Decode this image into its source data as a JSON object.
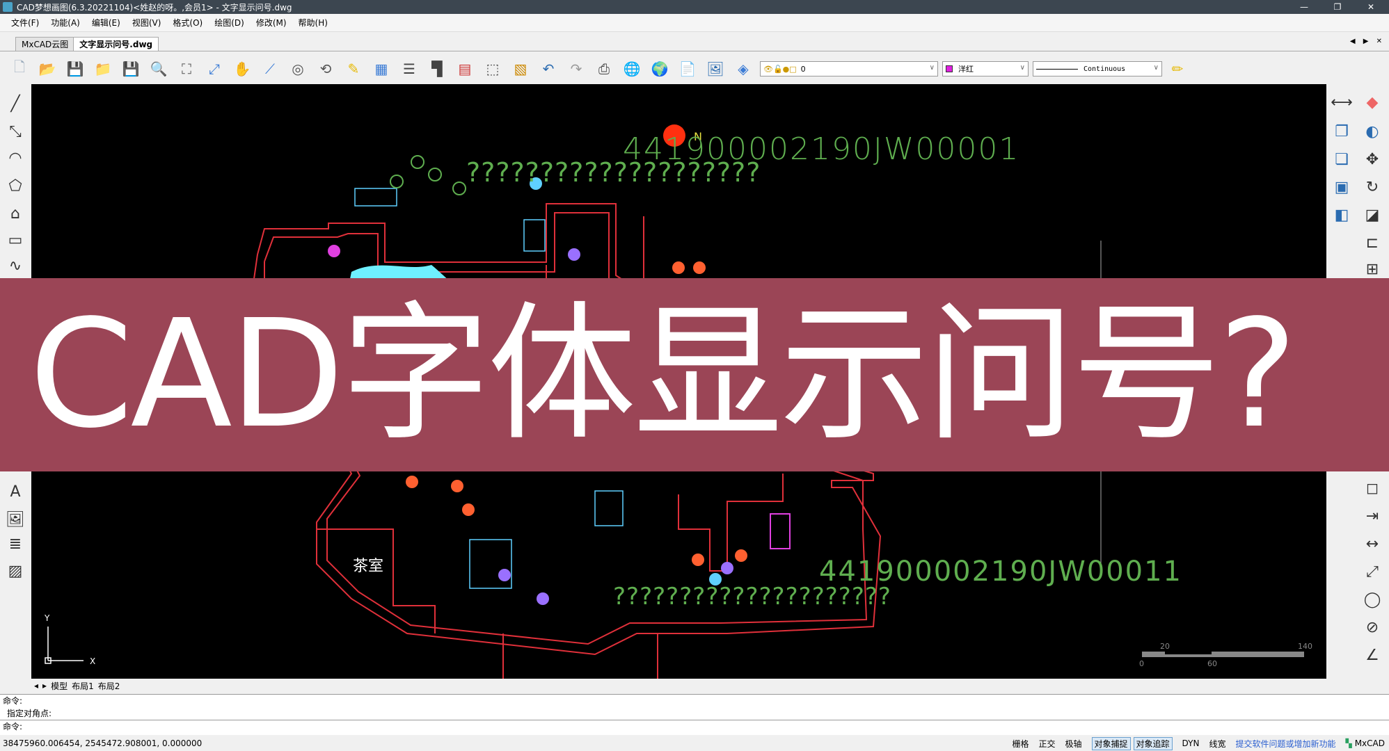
{
  "window": {
    "title": "CAD梦想画图(6.3.20221104)<姓赵的呀。,会员1> - 文字显示问号.dwg",
    "minimize": "—",
    "restore": "❐",
    "close": "✕"
  },
  "menu": [
    "文件(F)",
    "功能(A)",
    "编辑(E)",
    "视图(V)",
    "格式(O)",
    "绘图(D)",
    "修改(M)",
    "帮助(H)"
  ],
  "doc_tabs": [
    {
      "label": "MxCAD云图",
      "active": false
    },
    {
      "label": "文字显示问号.dwg",
      "active": true
    }
  ],
  "doc_tab_arrows": "◀ ▶ ✕",
  "toolbar": {
    "icons": [
      "new-file",
      "open-folder",
      "save",
      "open",
      "save-as",
      "zoom-in",
      "zoom-window",
      "zoom-extents",
      "pan-hand",
      "ucs",
      "zoom-realtime",
      "zoom-previous",
      "pencil",
      "properties",
      "layers-list",
      "block",
      "color-palette",
      "select",
      "match",
      "undo",
      "redo",
      "print",
      "web",
      "globe",
      "pdf",
      "image"
    ],
    "layer_value": "0",
    "color_value": "洋红",
    "color_swatch": "#e020e0",
    "linetype_value": "Continuous"
  },
  "canvas": {
    "text_top_code": "441900002190JW00001",
    "text_top_question": "????????????????????",
    "text_bottom_code": "441900002190JW00011",
    "text_bottom_question": "?????????????????????",
    "room_label": "茶室",
    "north_label": "N",
    "axis_x": "X",
    "axis_y": "Y",
    "scale_labels": [
      "0",
      "20",
      "60",
      "140"
    ],
    "colors": {
      "wall": "#e0303a",
      "pond": "#6ef0ff",
      "text": "#5fae4f",
      "background": "#000000"
    }
  },
  "banner": {
    "text": "CAD字体显示问号?",
    "color": "#9b4556"
  },
  "layout_tabs": [
    "模型",
    "布局1",
    "布局2"
  ],
  "command": {
    "lines": [
      "命令:",
      " 指定对角点:"
    ],
    "prompt": "命令:"
  },
  "status": {
    "coords": "38475960.006454,  2545472.908001,  0.000000",
    "toggles": [
      {
        "label": "栅格",
        "on": false
      },
      {
        "label": "正交",
        "on": false
      },
      {
        "label": "极轴",
        "on": false
      },
      {
        "label": "对象捕捉",
        "on": true
      },
      {
        "label": "对象追踪",
        "on": true
      },
      {
        "label": "DYN",
        "on": false
      },
      {
        "label": "线宽",
        "on": false
      }
    ],
    "feedback_link": "提交软件问题或增加新功能",
    "brand": "MxCAD"
  }
}
